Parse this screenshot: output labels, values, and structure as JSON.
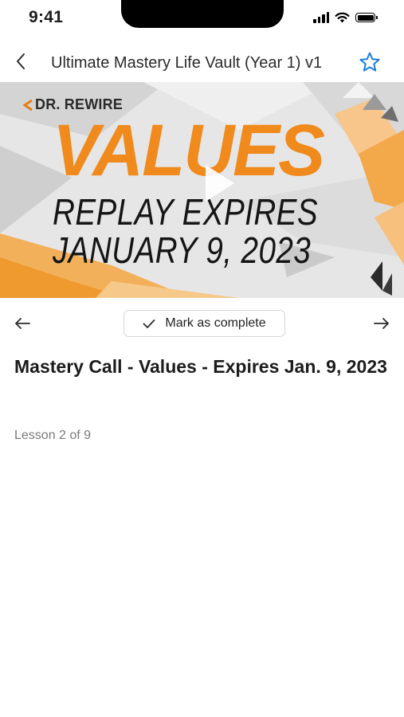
{
  "status_bar": {
    "time": "9:41",
    "icons": [
      "cellular-signal-icon",
      "wifi-icon",
      "battery-icon"
    ]
  },
  "header": {
    "back_icon": "chevron-left-icon",
    "title": "Ultimate Mastery Life Vault (Year 1) v1",
    "favorite_icon": "star-outline-icon",
    "accent_color": "#1a7fd6"
  },
  "video": {
    "brand": "DR. REWIRE",
    "headline": "VALUES",
    "line1": "REPLAY EXPIRES",
    "line2": "JANUARY 9, 2023",
    "play_icon": "play-icon",
    "headline_color": "#f08a1c"
  },
  "controls": {
    "prev_icon": "arrow-left-icon",
    "next_icon": "arrow-right-icon",
    "complete_label": "Mark as complete",
    "complete_icon": "checkmark-icon"
  },
  "lesson": {
    "title": "Mastery Call - Values - Expires Jan. 9, 2023",
    "progress": "Lesson 2 of 9"
  }
}
